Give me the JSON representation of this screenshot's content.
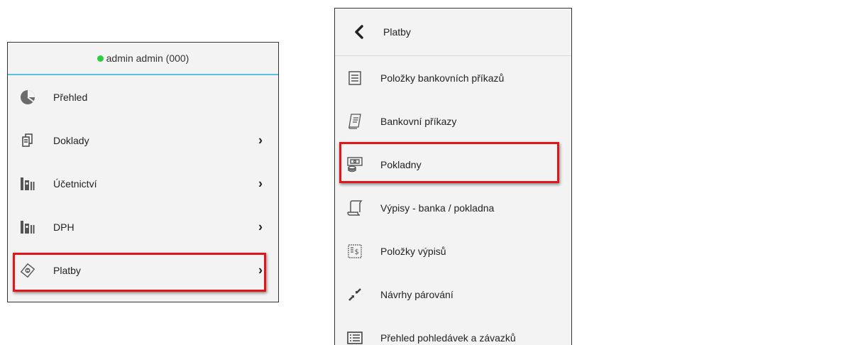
{
  "accent_colors": {
    "status_online": "#2ecc40",
    "divider": "#5bc0de",
    "highlight": "#e0161b"
  },
  "user": {
    "name": "admin admin (000)",
    "status": "online"
  },
  "main_menu": {
    "items": [
      {
        "label": "Přehled",
        "icon": "pie-chart-icon",
        "has_submenu": false
      },
      {
        "label": "Doklady",
        "icon": "documents-icon",
        "has_submenu": true
      },
      {
        "label": "Účetnictví",
        "icon": "books-icon",
        "has_submenu": true
      },
      {
        "label": "DPH",
        "icon": "books-icon",
        "has_submenu": true
      },
      {
        "label": "Platby",
        "icon": "payment-icon",
        "has_submenu": true,
        "highlighted": true
      }
    ]
  },
  "submenu": {
    "title": "Platby",
    "back_icon": "chevron-left-icon",
    "items": [
      {
        "label": "Položky bankovních příkazů",
        "icon": "list-document-icon"
      },
      {
        "label": "Bankovní příkazy",
        "icon": "receipt-icon"
      },
      {
        "label": "Pokladny",
        "icon": "cash-register-icon",
        "highlighted": true
      },
      {
        "label": "Výpisy - banka / pokladna",
        "icon": "scroll-icon"
      },
      {
        "label": "Položky výpisů",
        "icon": "statement-items-icon"
      },
      {
        "label": "Návrhy párování",
        "icon": "arrows-merge-icon"
      },
      {
        "label": "Přehled pohledávek a závazků",
        "icon": "list-overview-icon"
      }
    ]
  }
}
